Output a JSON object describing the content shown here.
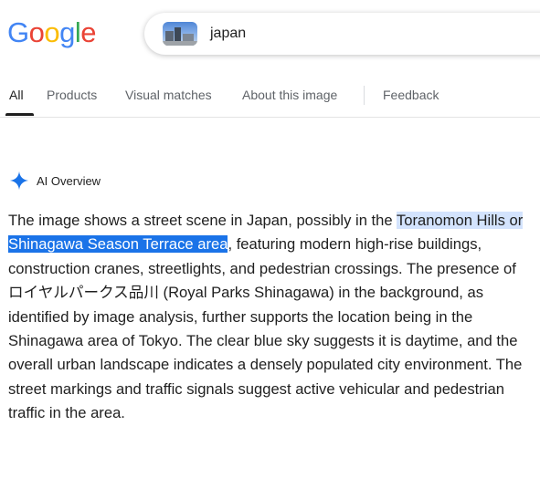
{
  "logo": {
    "letters": [
      "G",
      "o",
      "o",
      "g",
      "l",
      "e"
    ],
    "colors": [
      "#4285F4",
      "#EA4335",
      "#FBBC05",
      "#4285F4",
      "#34A853",
      "#EA4335"
    ]
  },
  "search": {
    "query": "japan"
  },
  "tabs": [
    {
      "label": "All",
      "active": true
    },
    {
      "label": "Products",
      "active": false
    },
    {
      "label": "Visual matches",
      "active": false
    },
    {
      "label": "About this image",
      "active": false
    },
    {
      "label": "Feedback",
      "active": false
    }
  ],
  "ai_overview": {
    "title": "AI Overview",
    "sparkle_color": "#1a73e8",
    "text_before": "The image shows a street scene in Japan, possibly in the ",
    "highlight_1": "Toranomon Hills or ",
    "highlight_2": "Shinagawa Season Terrace area",
    "text_after": ", featuring modern high-rise buildings, construction cranes, streetlights, and pedestrian crossings. The presence of ロイヤルパークス品川 (Royal Parks Shinagawa) in the background, as identified by image analysis, further supports the location being in the Shinagawa area of Tokyo. The clear blue sky suggests it is daytime, and the overall urban landscape indicates a densely populated city environment. The street markings and traffic signals suggest active vehicular and pedestrian traffic in the area."
  }
}
